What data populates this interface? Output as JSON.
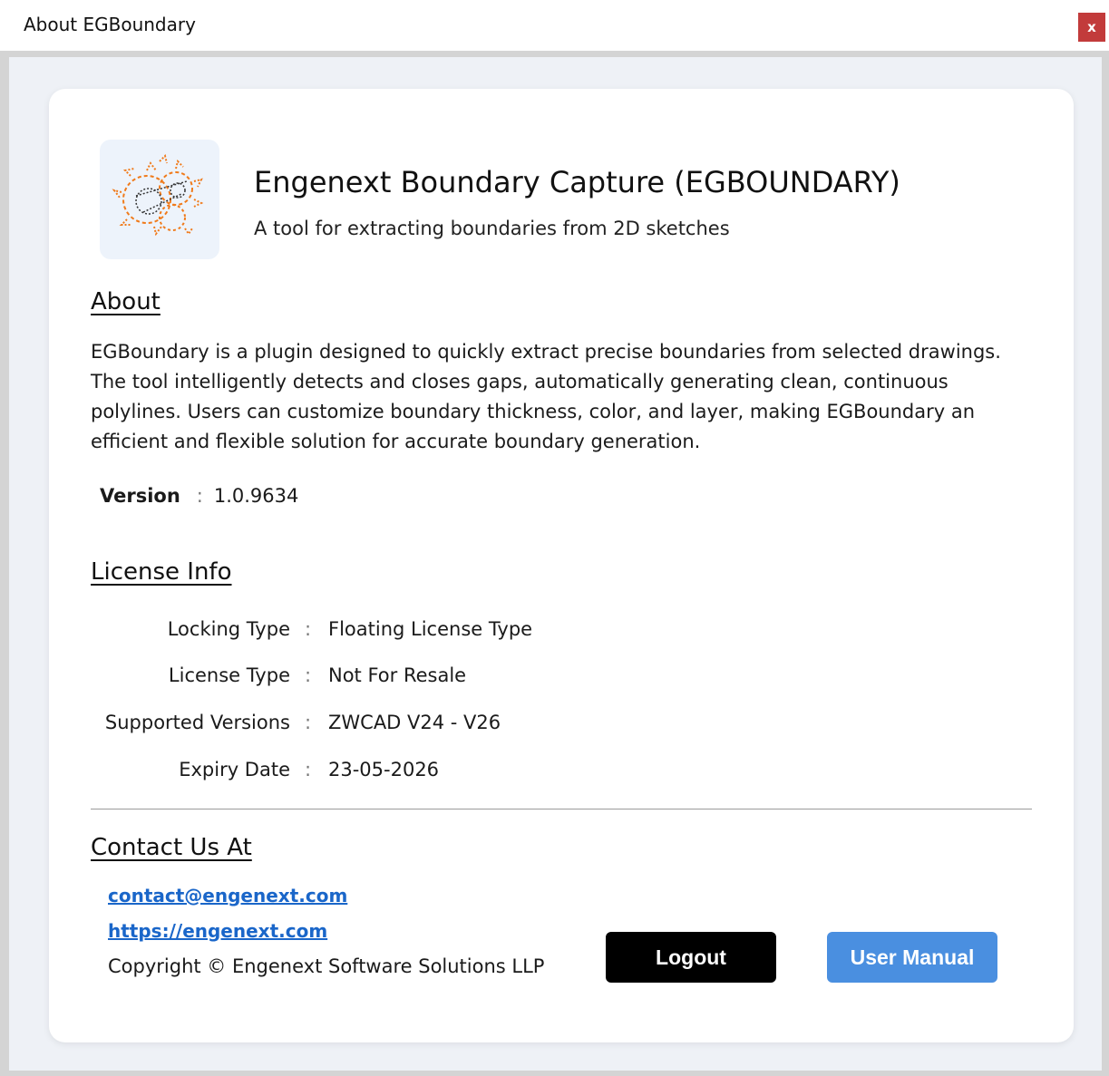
{
  "window": {
    "title": "About EGBoundary",
    "close_label": "x"
  },
  "header": {
    "app_title": "Engenext Boundary Capture (EGBOUNDARY)",
    "app_subtitle": "A tool for extracting boundaries from 2D sketches",
    "logo_icon": "gear-boundary-logo-icon"
  },
  "about": {
    "heading": "About",
    "description": "EGBoundary is a plugin designed to quickly extract precise boundaries from selected drawings. The tool intelligently detects and closes gaps, automatically generating clean, continuous polylines. Users can customize boundary thickness, color, and layer, making EGBoundary an efficient and flexible solution for accurate boundary generation.",
    "version_label": "Version",
    "version_sep": ":",
    "version_value": "1.0.9634"
  },
  "license": {
    "heading": "License Info",
    "rows": [
      {
        "label": "Locking Type",
        "sep": ":",
        "value": "Floating License Type"
      },
      {
        "label": "License Type",
        "sep": ":",
        "value": "Not For Resale"
      },
      {
        "label": "Supported Versions",
        "sep": ":",
        "value": "ZWCAD V24 - V26"
      },
      {
        "label": "Expiry Date",
        "sep": ":",
        "value": "23-05-2026"
      }
    ]
  },
  "contact": {
    "heading": "Contact Us At",
    "email": "contact@engenext.com",
    "website": "https://engenext.com",
    "copyright": "Copyright © Engenext Software Solutions LLP"
  },
  "buttons": {
    "logout_label": "Logout",
    "manual_label": "User Manual"
  },
  "colors": {
    "accent": "#4a8fe0",
    "link": "#1a66c9",
    "logo_orange": "#f07a1a",
    "close_red": "#c23b3b"
  }
}
